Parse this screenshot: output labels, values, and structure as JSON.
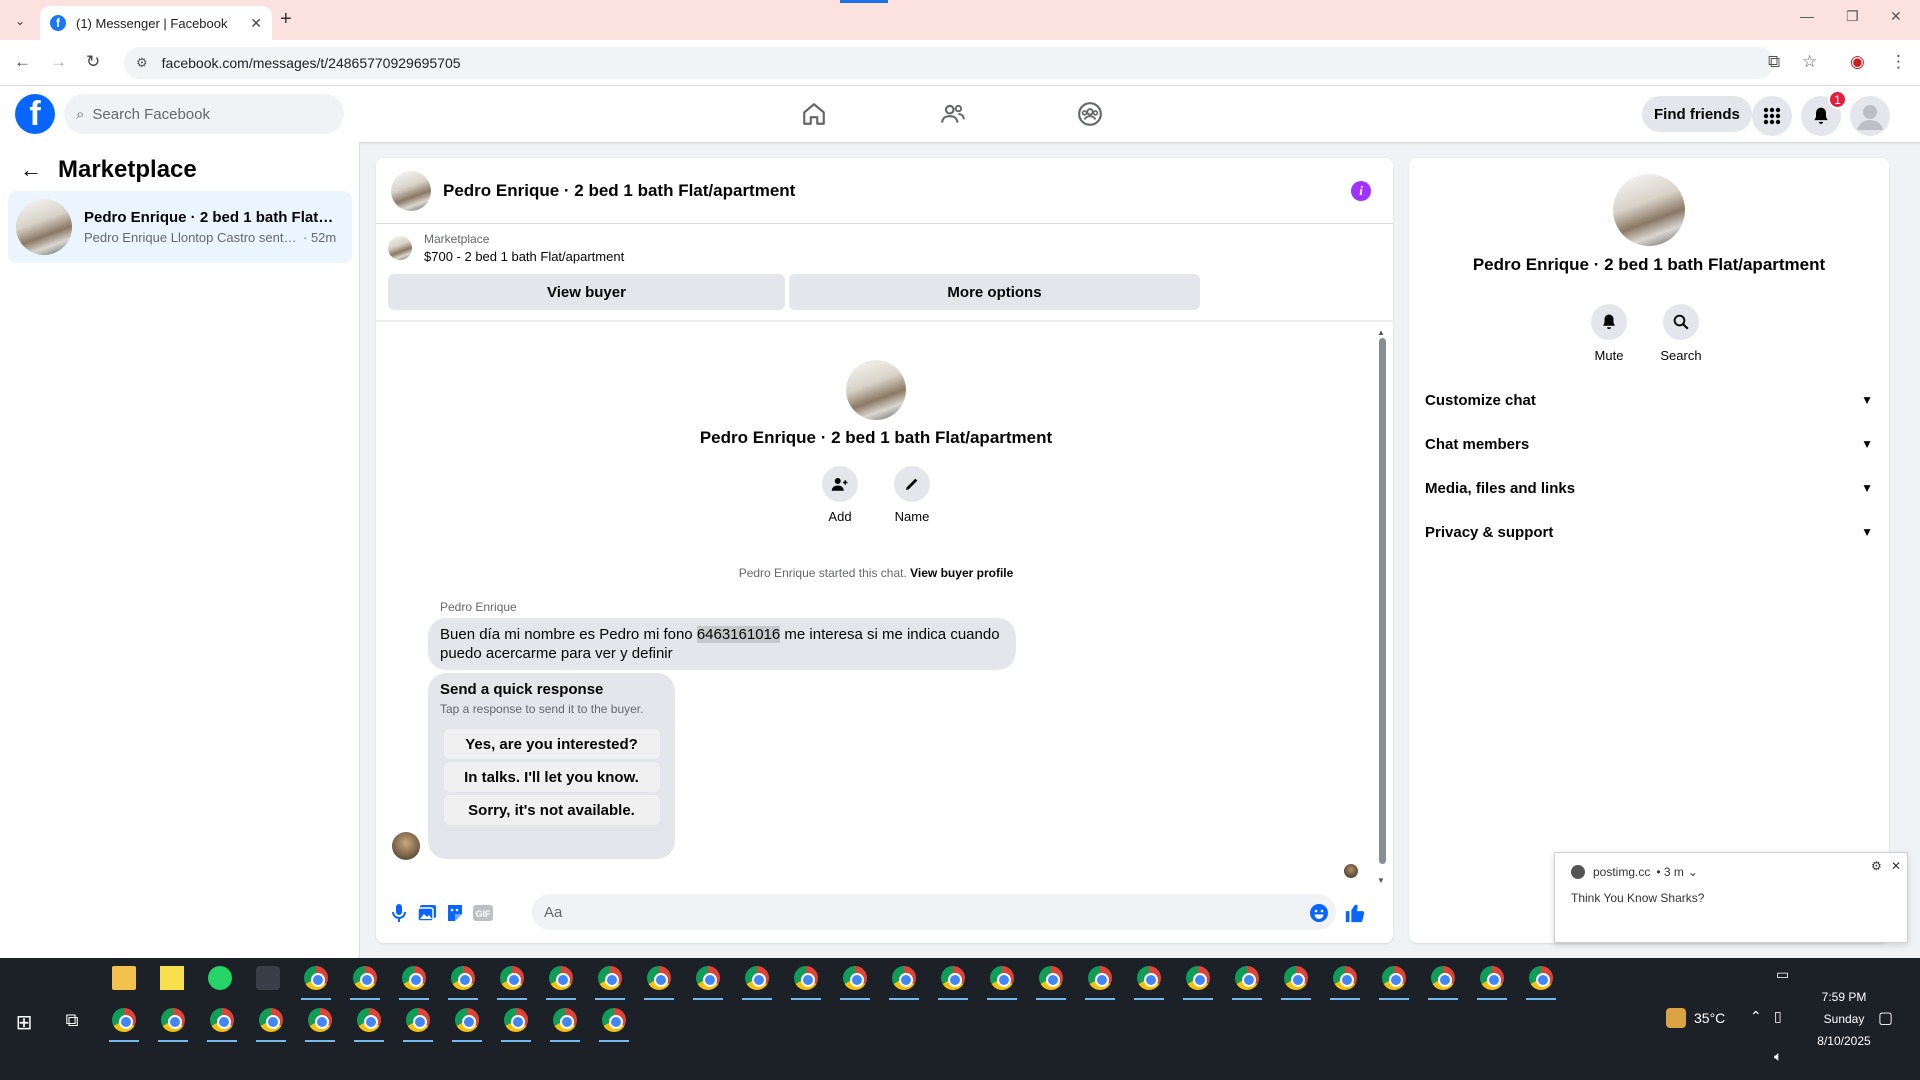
{
  "browser": {
    "tab_title": "(1) Messenger | Facebook",
    "url": "facebook.com/messages/t/24865770929695705"
  },
  "fbnav": {
    "search_placeholder": "Search Facebook",
    "find_friends": "Find friends",
    "notification_count": "1"
  },
  "left": {
    "title": "Marketplace",
    "conversation": {
      "name": "Pedro Enrique · 2 bed 1 bath Flat/apartment",
      "preview": "Pedro Enrique Llontop Castro sent y...",
      "time": "· 52m"
    }
  },
  "chat": {
    "header_name": "Pedro Enrique · 2 bed 1 bath Flat/apartment",
    "marketplace_label": "Marketplace",
    "listing": "$700 - 2 bed 1 bath Flat/apartment",
    "view_buyer": "View buyer",
    "more_options": "More options",
    "intro_name": "Pedro Enrique · 2 bed 1 bath Flat/apartment",
    "add_label": "Add",
    "name_label": "Name",
    "started_text": "Pedro Enrique started this chat.",
    "view_buyer_profile": "View buyer profile",
    "sender": "Pedro Enrique",
    "message_before": "Buen día mi nombre es Pedro mi fono ",
    "message_phone": "6463161016",
    "message_after": " me interesa si me indica cuando puedo acercarme para ver y definir",
    "quick_title": "Send a quick response",
    "quick_sub": "Tap a response to send it to the buyer.",
    "quick_responses": [
      "Yes, are you interested?",
      "In talks. I'll let you know.",
      "Sorry, it's not available."
    ],
    "composer_placeholder": "Aa"
  },
  "right": {
    "name": "Pedro Enrique · 2 bed 1 bath Flat/apartment",
    "mute": "Mute",
    "search": "Search",
    "items": [
      "Customize chat",
      "Chat members",
      "Media, files and links",
      "Privacy & support"
    ]
  },
  "notification": {
    "source": "postimg.cc",
    "time": "• 3 m",
    "message": "Think You Know Sharks?"
  },
  "taskbar": {
    "temperature": "35°C",
    "time": "7:59 PM",
    "day": "Sunday",
    "date": "8/10/2025"
  },
  "colors": {
    "fb_blue": "#0866ff",
    "selected_conv": "#ebf5ff",
    "info_purple": "#a033ff",
    "badge_red": "#e41e3f"
  }
}
